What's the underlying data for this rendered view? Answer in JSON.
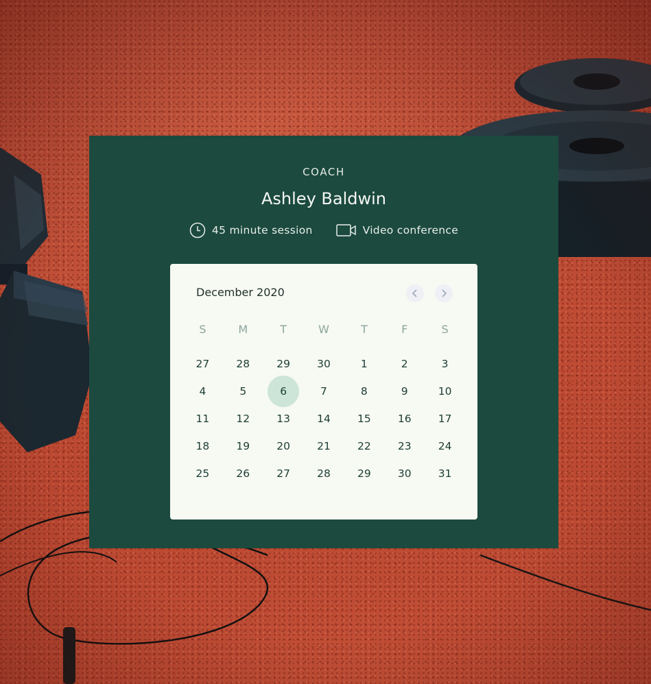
{
  "coach": {
    "role_label": "COACH",
    "name": "Ashley Baldwin"
  },
  "session": {
    "duration_label": "45 minute session",
    "duration_icon": "clock-icon",
    "format_label": "Video conference",
    "format_icon": "video-camera-icon"
  },
  "calendar": {
    "month_label": "December 2020",
    "prev_icon": "chevron-left-icon",
    "next_icon": "chevron-right-icon",
    "weekdays": [
      "S",
      "M",
      "T",
      "W",
      "T",
      "F",
      "S"
    ],
    "days": [
      "27",
      "28",
      "29",
      "30",
      "1",
      "2",
      "3",
      "4",
      "5",
      "6",
      "7",
      "8",
      "9",
      "10",
      "11",
      "12",
      "13",
      "14",
      "15",
      "16",
      "17",
      "18",
      "19",
      "20",
      "21",
      "22",
      "23",
      "24",
      "25",
      "26",
      "27",
      "28",
      "29",
      "30",
      "31"
    ],
    "selected_day": "6",
    "selected_index": 9
  },
  "colors": {
    "card_background": "#1c4a3e",
    "calendar_background": "#f7f9f3",
    "selected_day_highlight": "#cde5d9",
    "weekday_text": "#8aa69b"
  }
}
